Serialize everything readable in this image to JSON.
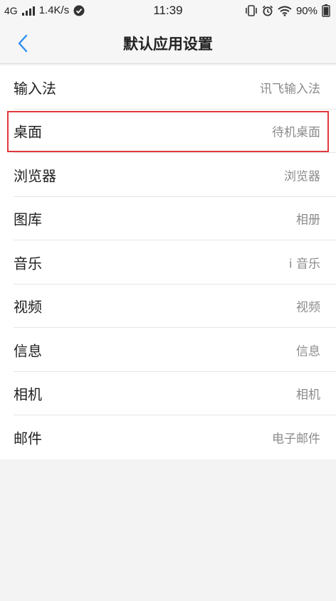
{
  "status_bar": {
    "network_type": "4G",
    "speed": "1.4K/s",
    "time": "11:39",
    "battery": "90%"
  },
  "header": {
    "title": "默认应用设置"
  },
  "settings": {
    "items": [
      {
        "label": "输入法",
        "value": "讯飞输入法"
      },
      {
        "label": "桌面",
        "value": "待机桌面"
      },
      {
        "label": "浏览器",
        "value": "浏览器"
      },
      {
        "label": "图库",
        "value": "相册"
      },
      {
        "label": "音乐",
        "value": "i 音乐"
      },
      {
        "label": "视频",
        "value": "视频"
      },
      {
        "label": "信息",
        "value": "信息"
      },
      {
        "label": "相机",
        "value": "相机"
      },
      {
        "label": "邮件",
        "value": "电子邮件"
      }
    ],
    "highlighted_item": "桌面"
  },
  "colors": {
    "accent": "#2f8ef4",
    "highlight": "#e0393e"
  }
}
